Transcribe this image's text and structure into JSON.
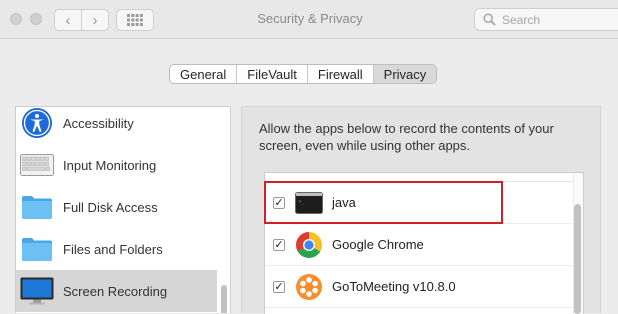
{
  "window": {
    "title": "Security & Privacy",
    "search": {
      "placeholder": "Search"
    }
  },
  "tabs": [
    {
      "label": "General",
      "active": false
    },
    {
      "label": "FileVault",
      "active": false
    },
    {
      "label": "Firewall",
      "active": false
    },
    {
      "label": "Privacy",
      "active": true
    }
  ],
  "sidebar": {
    "items": [
      {
        "label": "Accessibility",
        "icon": "accessibility-icon",
        "selected": false
      },
      {
        "label": "Input Monitoring",
        "icon": "keyboard-icon",
        "selected": false
      },
      {
        "label": "Full Disk Access",
        "icon": "folder-icon",
        "selected": false
      },
      {
        "label": "Files and Folders",
        "icon": "folder-icon",
        "selected": false
      },
      {
        "label": "Screen Recording",
        "icon": "display-icon",
        "selected": true
      }
    ]
  },
  "panel": {
    "description": "Allow the apps below to record the contents of your screen, even while using other apps.",
    "apps": [
      {
        "name": "java",
        "checked": true,
        "icon": "terminal-icon"
      },
      {
        "name": "Google Chrome",
        "checked": true,
        "icon": "chrome-icon"
      },
      {
        "name": "GoToMeeting v10.8.0",
        "checked": true,
        "icon": "gotomeeting-icon"
      }
    ]
  },
  "colors": {
    "highlight": "#d0202a",
    "selection": "#d6d6d6",
    "folder": "#5cb4f0",
    "accessibility": "#1f6ad9"
  }
}
